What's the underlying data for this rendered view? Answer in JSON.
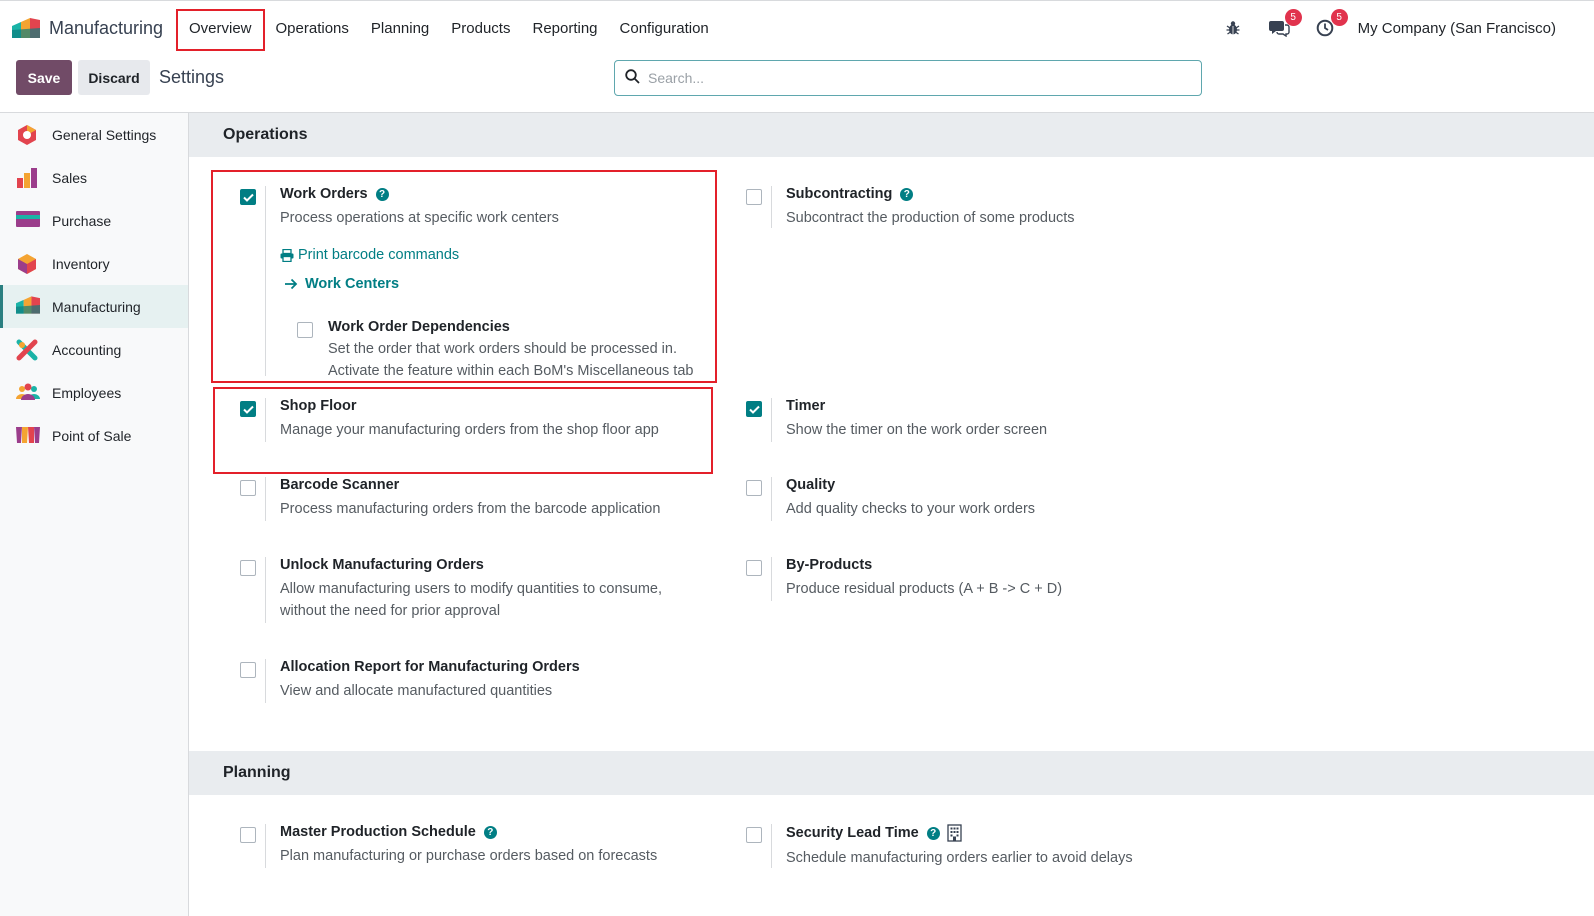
{
  "app": {
    "name": "Manufacturing"
  },
  "menu": {
    "overview": "Overview",
    "operations": "Operations",
    "planning": "Planning",
    "products": "Products",
    "reporting": "Reporting",
    "configuration": "Configuration"
  },
  "systray": {
    "messages_count": "5",
    "activities_count": "5",
    "company": "My Company (San Francisco)"
  },
  "control": {
    "save": "Save",
    "discard": "Discard",
    "title": "Settings",
    "search_placeholder": "Search..."
  },
  "sidebar": {
    "general": "General Settings",
    "sales": "Sales",
    "purchase": "Purchase",
    "inventory": "Inventory",
    "manufacturing": "Manufacturing",
    "accounting": "Accounting",
    "employees": "Employees",
    "pos": "Point of Sale"
  },
  "sections": {
    "operations": "Operations",
    "planning": "Planning"
  },
  "settings": {
    "work_orders": {
      "title": "Work Orders",
      "desc": "Process operations at specific work centers",
      "checked": true
    },
    "print_barcode": "Print barcode commands",
    "work_centers": "Work Centers",
    "dependencies": {
      "title": "Work Order Dependencies",
      "desc1": "Set the order that work orders should be processed in.",
      "desc2": "Activate the feature within each BoM's Miscellaneous tab",
      "checked": false
    },
    "subcontracting": {
      "title": "Subcontracting",
      "desc": "Subcontract the production of some products",
      "checked": false
    },
    "shop_floor": {
      "title": "Shop Floor",
      "desc": "Manage your manufacturing orders from the shop floor app",
      "checked": true
    },
    "timer": {
      "title": "Timer",
      "desc": "Show the timer on the work order screen",
      "checked": true
    },
    "barcode_scanner": {
      "title": "Barcode Scanner",
      "desc": "Process manufacturing orders from the barcode application",
      "checked": false
    },
    "quality": {
      "title": "Quality",
      "desc": "Add quality checks to your work orders",
      "checked": false
    },
    "unlock": {
      "title": "Unlock Manufacturing Orders",
      "desc1": "Allow manufacturing users to modify quantities to consume,",
      "desc2": "without the need for prior approval",
      "checked": false
    },
    "byproducts": {
      "title": "By-Products",
      "desc": "Produce residual products (A + B -> C + D)",
      "checked": false
    },
    "allocation": {
      "title": "Allocation Report for Manufacturing Orders",
      "desc": "View and allocate manufactured quantities",
      "checked": false
    },
    "mps": {
      "title": "Master Production Schedule",
      "desc": "Plan manufacturing or purchase orders based on forecasts",
      "checked": false
    },
    "lead_time": {
      "title": "Security Lead Time",
      "desc": "Schedule manufacturing orders earlier to avoid delays",
      "checked": false
    }
  },
  "colors": {
    "primary": "#714b67",
    "accent": "#017e84",
    "highlight": "#e3202a"
  }
}
